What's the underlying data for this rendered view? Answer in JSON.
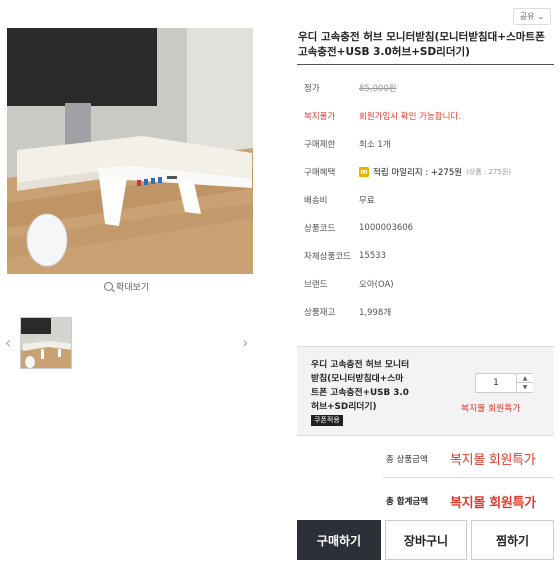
{
  "share": {
    "label": "공유"
  },
  "product": {
    "title": "우디 고속충전 허브 모니터받침(모니터받침대+스마트폰 고속충전+USB 3.0허브+SD리더기)"
  },
  "zoom_label": "확대보기",
  "info": {
    "price_label": "정가",
    "price_value": "85,000원",
    "welfare_label": "복지몰가",
    "welfare_value": "회원가입시 확인 가능합니다.",
    "limit_label": "구매제한",
    "limit_value": "최소 1개",
    "benefit_label": "구매혜택",
    "benefit_badge": "m",
    "benefit_value": "적립 마일리지 : +275원",
    "benefit_sub": "(상품 : 275원)",
    "shipping_label": "배송비",
    "shipping_value": "무료",
    "code_label": "상품코드",
    "code_value": "1000003606",
    "own_code_label": "자체상품코드",
    "own_code_value": "15533",
    "brand_label": "브랜드",
    "brand_value": "오아(OA)",
    "stock_label": "상품재고",
    "stock_value": "1,998개"
  },
  "option": {
    "name": "우디 고속충전 허브 모니터받침(모니터받침대+스마트폰 고속충전+USB 3.0허브+SD리더기)",
    "coupon": "쿠폰적용",
    "quantity": "1",
    "price": "복지몰 회원특가"
  },
  "totals": {
    "product_label": "총 상품금액",
    "product_value": "복지몰 회원특가",
    "sum_label": "총 합계금액",
    "sum_value": "복지몰 회원특가"
  },
  "buttons": {
    "buy": "구매하기",
    "cart": "장바구니",
    "wish": "찜하기"
  },
  "icons": {
    "share_caret": "chevron-down-icon",
    "zoom": "magnifier-icon",
    "prev": "chevron-left-icon",
    "next": "chevron-right-icon",
    "mileage": "mileage-badge-icon"
  },
  "colors": {
    "accent_red": "#e23b2e",
    "buy_button": "#2c3038"
  }
}
